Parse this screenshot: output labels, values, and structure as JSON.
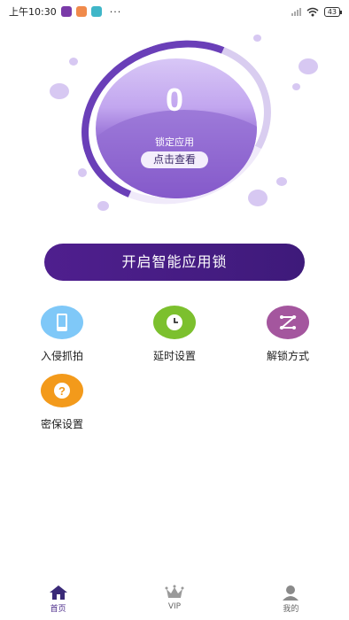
{
  "status_bar": {
    "time": "上午10:30",
    "more": "···",
    "battery": "43"
  },
  "hero": {
    "locked_count": "0",
    "locked_label": "锁定应用",
    "view_button": "点击查看"
  },
  "main_action": {
    "label": "开启智能应用锁"
  },
  "features": [
    {
      "label": "入侵抓拍",
      "icon": "phone-icon",
      "color": "#7fc8f8"
    },
    {
      "label": "延时设置",
      "icon": "clock-icon",
      "color": "#7cc02e"
    },
    {
      "label": "解锁方式",
      "icon": "pattern-icon",
      "color": "#a4569e"
    },
    {
      "label": "密保设置",
      "icon": "question-icon",
      "color": "#f39a1b"
    }
  ],
  "bottom_nav": [
    {
      "label": "首页",
      "icon": "home-icon",
      "active": true
    },
    {
      "label": "VIP",
      "icon": "crown-icon",
      "active": false
    },
    {
      "label": "我的",
      "icon": "user-icon",
      "active": false
    }
  ],
  "colors": {
    "accent": "#4f1f8e",
    "ring": "#6a3fb8"
  }
}
